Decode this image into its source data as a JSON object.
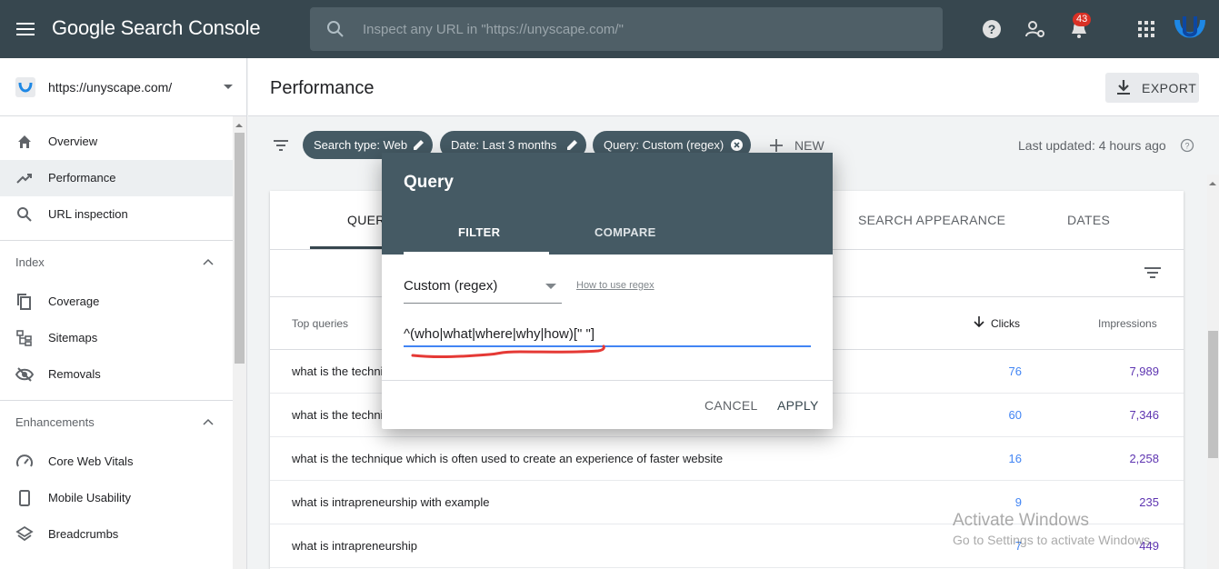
{
  "topbar": {
    "brand": "Google Search Console",
    "search_placeholder": "Inspect any URL in \"https://unyscape.com/\"",
    "notification_count": "43"
  },
  "sidebar": {
    "property_url": "https://unyscape.com/",
    "items_top": [
      {
        "label": "Overview",
        "icon": "home-icon"
      },
      {
        "label": "Performance",
        "icon": "trending-up-icon"
      },
      {
        "label": "URL inspection",
        "icon": "search-icon"
      }
    ],
    "index_header": "Index",
    "index_items": [
      {
        "label": "Coverage",
        "icon": "file-copy-icon"
      },
      {
        "label": "Sitemaps",
        "icon": "sitemap-icon"
      },
      {
        "label": "Removals",
        "icon": "eye-off-icon"
      }
    ],
    "enhancements_header": "Enhancements",
    "enhancement_items": [
      {
        "label": "Core Web Vitals",
        "icon": "speedometer-icon"
      },
      {
        "label": "Mobile Usability",
        "icon": "phone-icon"
      },
      {
        "label": "Breadcrumbs",
        "icon": "layers-icon"
      }
    ]
  },
  "header": {
    "title": "Performance",
    "export_label": "EXPORT"
  },
  "filters": {
    "chips": [
      "Search type: Web",
      "Date: Last 3 months",
      "Query: Custom (regex)"
    ],
    "new_label": "NEW",
    "last_updated": "Last updated: 4 hours ago"
  },
  "card": {
    "tabs": [
      "QUERIES",
      "SEARCH APPEARANCE",
      "DATES"
    ],
    "columns": {
      "queries": "Top queries",
      "clicks": "Clicks",
      "impressions": "Impressions"
    },
    "rows": [
      {
        "query": "what is the technique which is often used to create an experience of faster website",
        "clicks": "76",
        "impressions": "7,989"
      },
      {
        "query": "what is the technique which is often used to create an experience of faster website",
        "clicks": "60",
        "impressions": "7,346"
      },
      {
        "query": "what is the technique which is often used to create an experience of faster website",
        "clicks": "16",
        "impressions": "2,258"
      },
      {
        "query": "what is intrapreneurship with example",
        "clicks": "9",
        "impressions": "235"
      },
      {
        "query": "what is intrapreneurship",
        "clicks": "7",
        "impressions": "449"
      }
    ]
  },
  "dialog": {
    "title": "Query",
    "tab_filter": "FILTER",
    "tab_compare": "COMPARE",
    "select_value": "Custom (regex)",
    "help_link": "How to use regex",
    "regex_value": "^(who|what|where|why|how)[\" \"]",
    "cancel": "CANCEL",
    "apply": "APPLY"
  },
  "watermark": {
    "title": "Activate Windows",
    "subtitle": "Go to Settings to activate Windows."
  },
  "colors": {
    "topbar": "#37474f",
    "chip": "#455a64",
    "clicks": "#4285f4",
    "impressions": "#5e35b1"
  }
}
